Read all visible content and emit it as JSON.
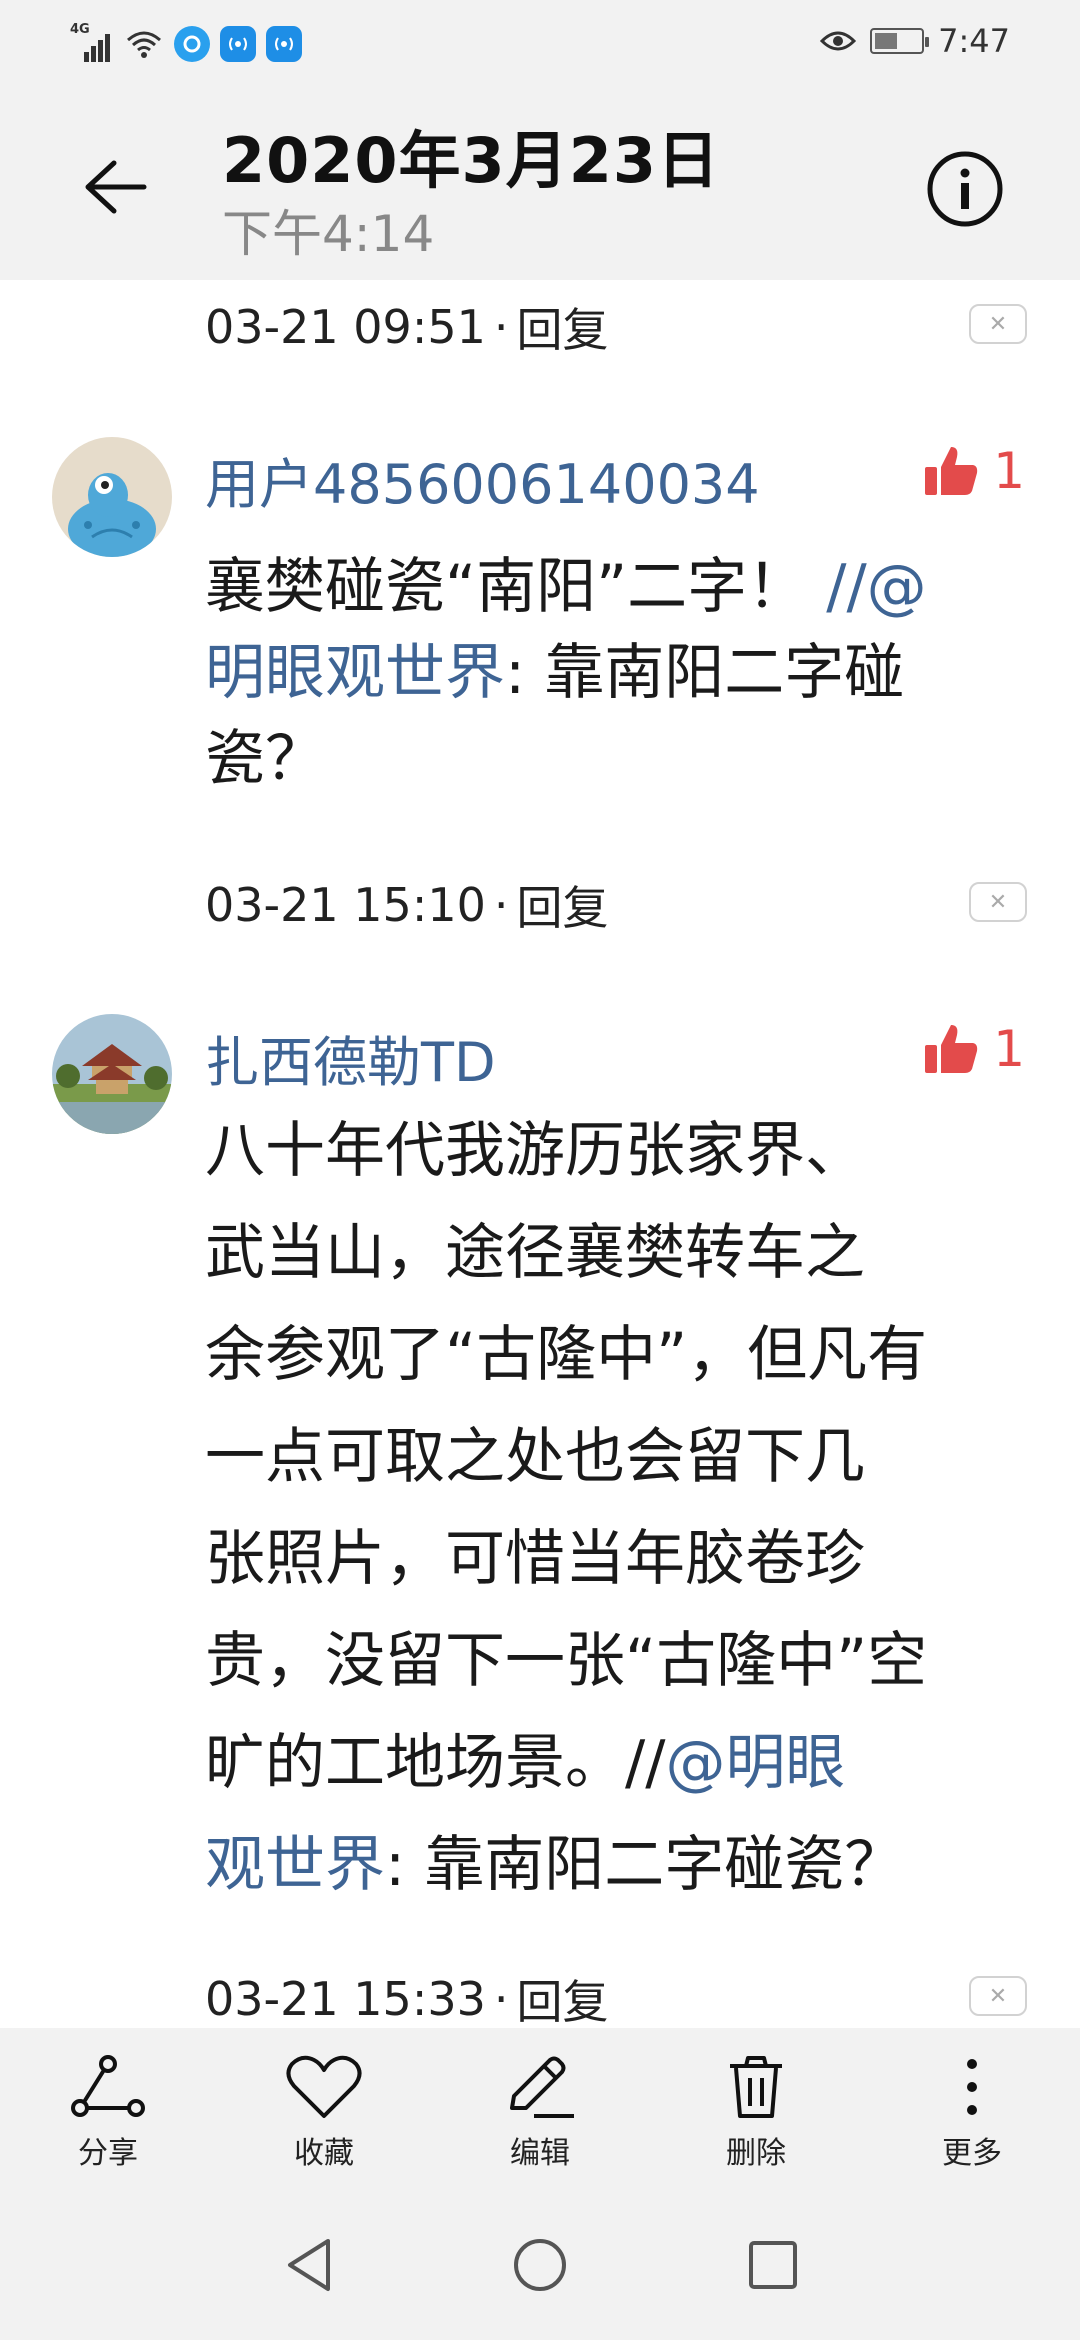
{
  "status_bar": {
    "network_label": "4G",
    "time": "7:47"
  },
  "header": {
    "title": "2020年3月23日",
    "subtitle": "下午4:14"
  },
  "comments": [
    {
      "time": "03-21 09:51",
      "reply_label": "回复"
    },
    {
      "username": "用户4856006140034",
      "likes": "1",
      "text_lines": [
        "襄樊碰瓷“南阳”二字！ //@",
        "明眼观世界: 靠南阳二字碰",
        "瓷？"
      ],
      "mention_prefix": "//@",
      "mention_line2": "明眼观世界",
      "line2_rest": ": 靠南阳二字碰",
      "line1_plain": "襄樊碰瓷“南阳”二字！ ",
      "line3": "瓷？",
      "time": "03-21 15:10",
      "reply_label": "回复"
    },
    {
      "username": "扎西德勒TD",
      "likes": "1",
      "lines": [
        "八十年代我游历张家界、",
        "武当山，途径襄樊转车之",
        "余参观了“古隆中”，但凡有",
        "一点可取之处也会留下几",
        "张照片，可惜当年胶卷珍",
        "贵，没留下一张“古隆中”空"
      ],
      "line7_plain": "旷的工地场景。//",
      "line7_mention": "@明眼",
      "line8_mention": "观世界",
      "line8_rest": ": 靠南阳二字碰瓷？",
      "time": "03-21 15:33",
      "reply_label": "回复"
    }
  ],
  "action_bar": {
    "share": "分享",
    "favorite": "收藏",
    "edit": "编辑",
    "delete": "删除",
    "more": "更多"
  },
  "colors": {
    "mention": "#3e6494",
    "like": "#e34b4b",
    "bar_bg": "#f2f2f2"
  }
}
